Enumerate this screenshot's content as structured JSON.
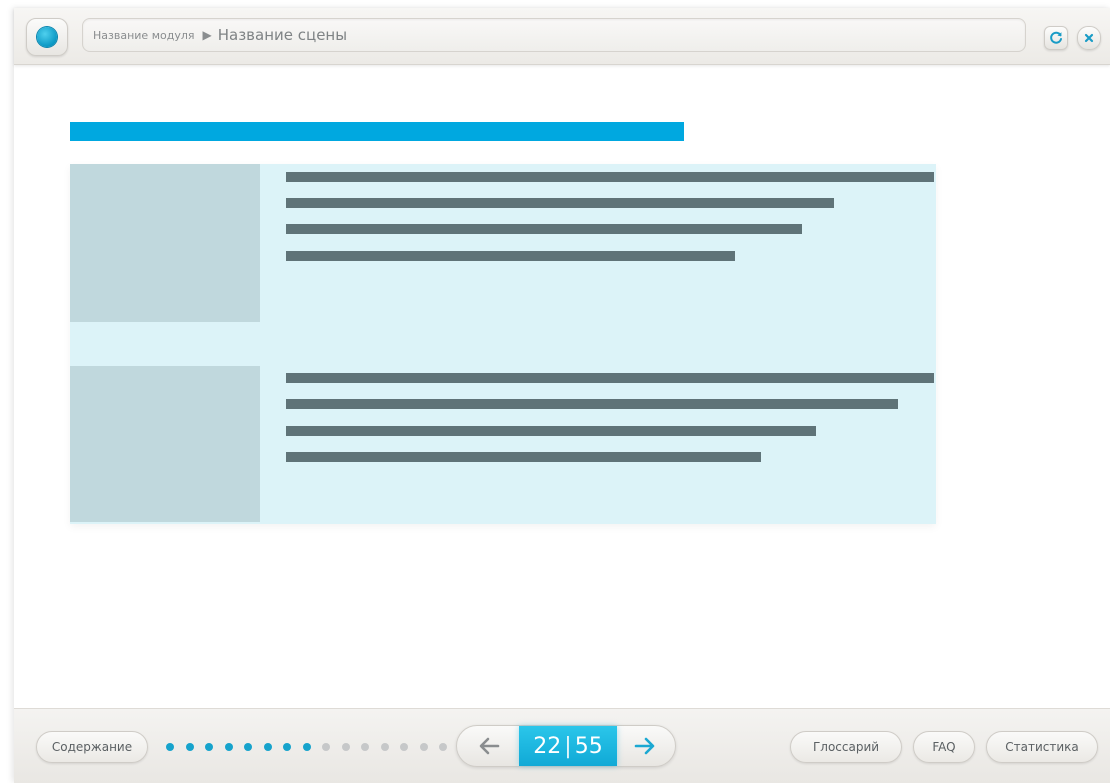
{
  "header": {
    "module_name": "Название модуля",
    "separator": "▶",
    "scene_name": "Название сцены"
  },
  "footer": {
    "contents_label": "Содержание",
    "glossary_label": "Глоссарий",
    "faq_label": "FAQ",
    "stats_label": "Статистика",
    "progress_dots": {
      "filled": 8,
      "total": 15
    },
    "pager": {
      "current": "22",
      "separator": "|",
      "total": "55"
    }
  },
  "colors": {
    "accent": "#00a8e0",
    "panel_bg": "#dcf3f8",
    "thumb_bg": "#c0d8dd",
    "text_line": "#5f7378",
    "dot_active": "#16a3cc",
    "dot_inactive": "#c6c8c9"
  },
  "icons": {
    "logo": "logo-orb-icon",
    "refresh": "refresh-icon",
    "close": "close-icon",
    "prev": "arrow-left-icon",
    "next": "arrow-right-icon"
  }
}
